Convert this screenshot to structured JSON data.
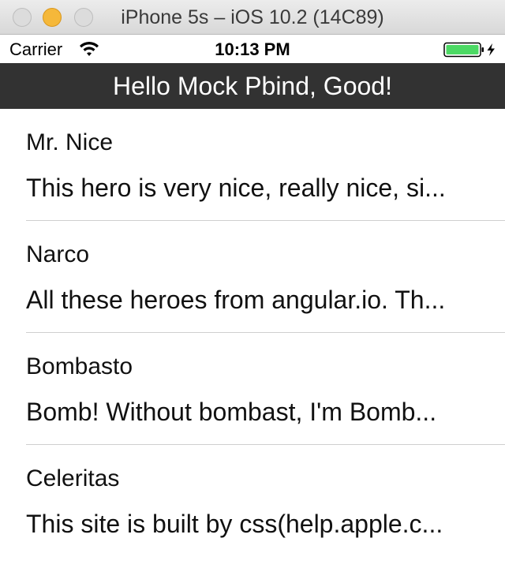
{
  "window": {
    "title": "iPhone 5s – iOS 10.2 (14C89)"
  },
  "status_bar": {
    "carrier": "Carrier",
    "time": "10:13 PM",
    "icons": [
      "wifi-icon",
      "battery-icon",
      "charging-bolt-icon"
    ],
    "battery_level": 1.0,
    "battery_color": "#4cd964"
  },
  "nav_bar": {
    "title": "Hello Mock Pbind, Good!",
    "background": "#323232"
  },
  "heroes": [
    {
      "name": "Mr. Nice",
      "description": "This hero is very nice, really nice, si..."
    },
    {
      "name": "Narco",
      "description": "All these heroes from angular.io. Th..."
    },
    {
      "name": "Bombasto",
      "description": "Bomb! Without bombast, I'm Bomb..."
    },
    {
      "name": "Celeritas",
      "description": "This site is built by css(help.apple.c..."
    }
  ]
}
